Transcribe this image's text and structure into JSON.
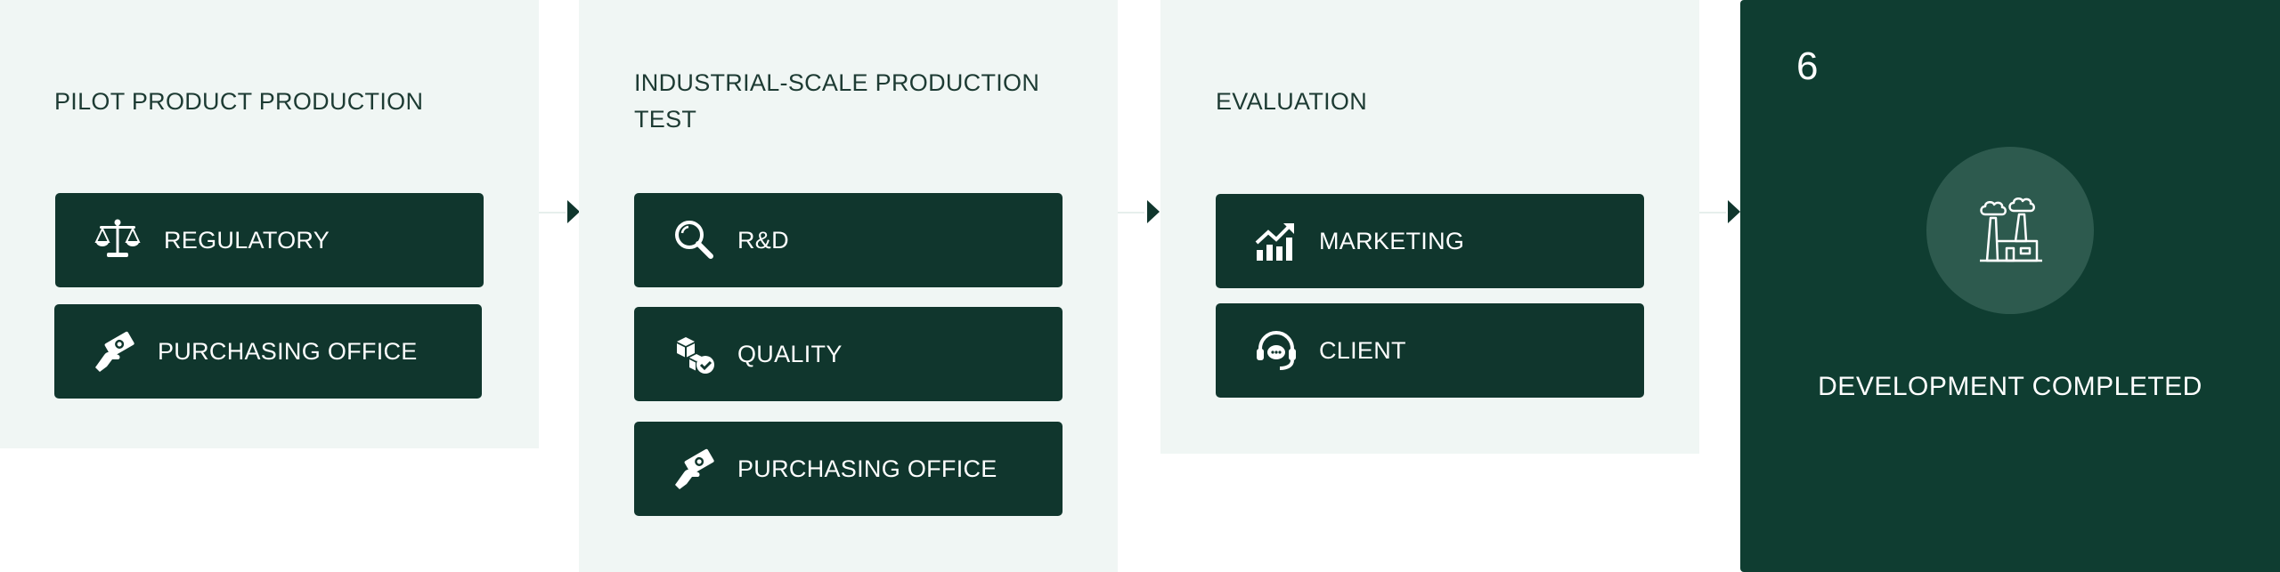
{
  "stages": [
    {
      "title": "PILOT PRODUCT PRODUCTION",
      "items": [
        {
          "label": "REGULATORY",
          "icon": "scale-icon"
        },
        {
          "label": "PURCHASING OFFICE",
          "icon": "money-hand-icon"
        }
      ]
    },
    {
      "title_lines": [
        "INDUSTRIAL-SCALE PRODUCTION",
        "TEST"
      ],
      "items": [
        {
          "label": "R&D",
          "icon": "magnifier-icon"
        },
        {
          "label": "QUALITY",
          "icon": "boxes-check-icon"
        },
        {
          "label": "PURCHASING OFFICE",
          "icon": "money-hand-icon"
        }
      ]
    },
    {
      "title": "EVALUATION",
      "items": [
        {
          "label": "MARKETING",
          "icon": "growth-chart-icon"
        },
        {
          "label": "CLIENT",
          "icon": "headset-icon"
        }
      ]
    }
  ],
  "final": {
    "number": "6",
    "label": "DEVELOPMENT COMPLETED",
    "icon": "factory-icon"
  },
  "colors": {
    "panel_bg": "#f0f6f4",
    "chip_bg": "#10362d",
    "final_bg": "#0f3d31",
    "circle_bg": "#2d5a4e",
    "title_text": "#1d3b33"
  }
}
